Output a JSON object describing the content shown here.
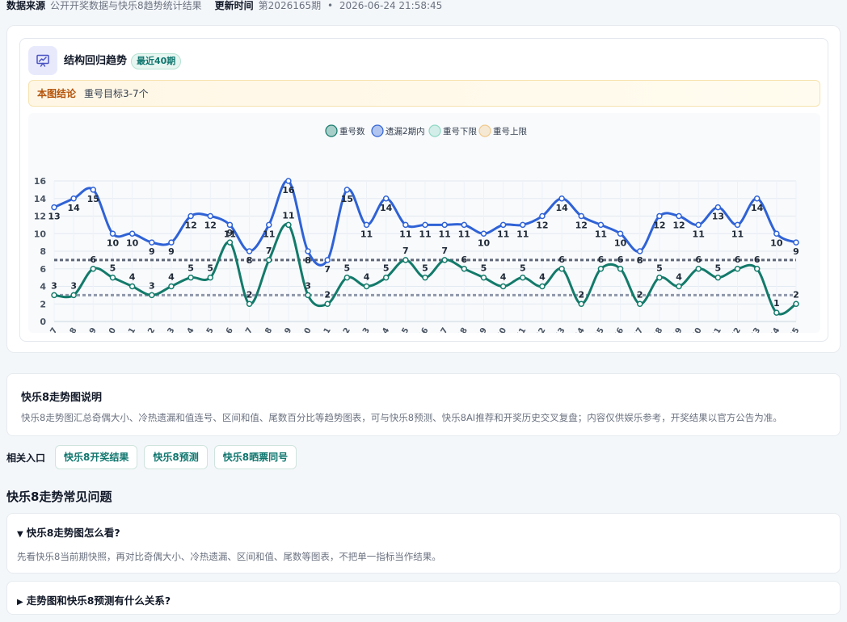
{
  "meta": {
    "source_label": "数据来源",
    "source_value": "公开开奖数据与快乐8趋势统计结果",
    "updated_label": "更新时间",
    "updated_period": "第2026165期",
    "updated_sep": "•",
    "updated_time": "2026-06-24 21:58:45"
  },
  "chart_card": {
    "icon": "trend-chart-icon",
    "title": "结构回归趋势",
    "badge": "最近40期",
    "conclusion_label": "本图结论",
    "conclusion_text": "重号目标3-7个"
  },
  "chart_data": {
    "type": "line",
    "x": [
      "2026127",
      "2026128",
      "2026129",
      "2026130",
      "2026131",
      "2026132",
      "2026133",
      "2026134",
      "2026135",
      "2026136",
      "2026137",
      "2026138",
      "2026139",
      "2026140",
      "2026141",
      "2026142",
      "2026143",
      "2026144",
      "2026145",
      "2026146",
      "2026147",
      "2026148",
      "2026149",
      "2026150",
      "2026151",
      "2026152",
      "2026153",
      "2026154",
      "2026155",
      "2026156",
      "2026157",
      "2026158",
      "2026159",
      "2026160",
      "2026161",
      "2026162",
      "2026163",
      "2026164",
      "2026165"
    ],
    "series": [
      {
        "name": "重号数",
        "color": "#137a6a",
        "values": [
          3,
          3,
          6,
          5,
          4,
          3,
          4,
          5,
          5,
          9,
          2,
          7,
          11,
          3,
          2,
          5,
          4,
          5,
          7,
          5,
          7,
          6,
          5,
          4,
          5,
          4,
          6,
          2,
          6,
          6,
          2,
          5,
          4,
          6,
          5,
          6,
          6,
          1,
          2
        ]
      },
      {
        "name": "遗漏2期内",
        "color": "#2f62d6",
        "values": [
          13,
          14,
          15,
          10,
          10,
          9,
          9,
          12,
          12,
          11,
          8,
          11,
          16,
          8,
          7,
          15,
          11,
          14,
          11,
          11,
          11,
          11,
          10,
          11,
          11,
          12,
          14,
          12,
          11,
          10,
          8,
          12,
          12,
          11,
          13,
          11,
          14,
          10,
          9
        ]
      },
      {
        "name": "重号下限",
        "color": "#8e97aa",
        "values": [
          3,
          3,
          3,
          3,
          3,
          3,
          3,
          3,
          3,
          3,
          3,
          3,
          3,
          3,
          3,
          3,
          3,
          3,
          3,
          3,
          3,
          3,
          3,
          3,
          3,
          3,
          3,
          3,
          3,
          3,
          3,
          3,
          3,
          3,
          3,
          3,
          3,
          3,
          3
        ]
      },
      {
        "name": "重号上限",
        "color": "#5f6778",
        "values": [
          7,
          7,
          7,
          7,
          7,
          7,
          7,
          7,
          7,
          7,
          7,
          7,
          7,
          7,
          7,
          7,
          7,
          7,
          7,
          7,
          7,
          7,
          7,
          7,
          7,
          7,
          7,
          7,
          7,
          7,
          7,
          7,
          7,
          7,
          7,
          7,
          7,
          7,
          7
        ]
      }
    ],
    "legend_colors": [
      "#137a6a",
      "#2f62d6",
      "#8fd8c4",
      "#f0c98a"
    ],
    "ylim": [
      0,
      16
    ],
    "yticks": [
      0,
      2,
      4,
      6,
      8,
      10,
      12,
      14,
      16
    ],
    "legend_position": "top-center",
    "grid": true
  },
  "description": {
    "title": "快乐8走势图说明",
    "text": "快乐8走势图汇总奇偶大小、冷热遗漏和值连号、区间和值、尾数百分比等趋势图表，可与快乐8预测、快乐8AI推荐和开奖历史交叉复盘；内容仅供娱乐参考，开奖结果以官方公告为准。"
  },
  "related": {
    "label": "相关入口",
    "links": [
      "快乐8开奖结果",
      "快乐8预测",
      "快乐8晒票同号"
    ]
  },
  "faq": {
    "heading": "快乐8走势常见问题",
    "items": [
      {
        "marker": "▼",
        "question": "快乐8走势图怎么看?",
        "answer": "先看快乐8当前期快照，再对比奇偶大小、冷热遗漏、区间和值、尾数等图表，不把单一指标当作结果。"
      },
      {
        "marker": "▶",
        "question": "走势图和快乐8预测有什么关系?"
      }
    ]
  }
}
